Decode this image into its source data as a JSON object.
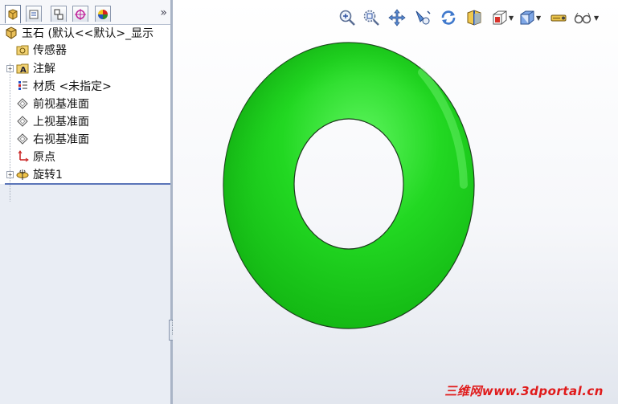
{
  "feature_tree": {
    "root_label": "玉石 (默认<<默认>_显示",
    "items": [
      {
        "label": "传感器",
        "icon": "sensor-folder-icon",
        "expandable": false
      },
      {
        "label": "注解",
        "icon": "annotation-icon",
        "expandable": true
      },
      {
        "label": "材质 <未指定>",
        "icon": "material-icon",
        "expandable": false
      },
      {
        "label": "前视基准面",
        "icon": "plane-icon",
        "expandable": false
      },
      {
        "label": "上视基准面",
        "icon": "plane-icon",
        "expandable": false
      },
      {
        "label": "右视基准面",
        "icon": "plane-icon",
        "expandable": false
      },
      {
        "label": "原点",
        "icon": "origin-icon",
        "expandable": false
      },
      {
        "label": "旋转1",
        "icon": "revolve-feature-icon",
        "expandable": true
      }
    ]
  },
  "panel_tabs": [
    "feature-manager-tab",
    "property-manager-tab",
    "configuration-manager-tab",
    "dimxpert-tab",
    "display-manager-tab"
  ],
  "panel_more_label": "»",
  "view_toolbar": [
    "zoom-to-fit-icon",
    "zoom-to-area-icon",
    "pan-icon",
    "previous-view-icon",
    "rotate-icon",
    "section-view-icon",
    "view-orientation-icon",
    "display-style-icon",
    "hide-show-icon",
    "view-settings-icon"
  ],
  "model": {
    "shape": "torus",
    "color": "#1ed21e"
  },
  "watermark": "三维网www.3dportal.cn",
  "colors": {
    "accent": "#5a74b8",
    "model_green": "#1ed21e",
    "watermark_red": "#e01a1a"
  }
}
